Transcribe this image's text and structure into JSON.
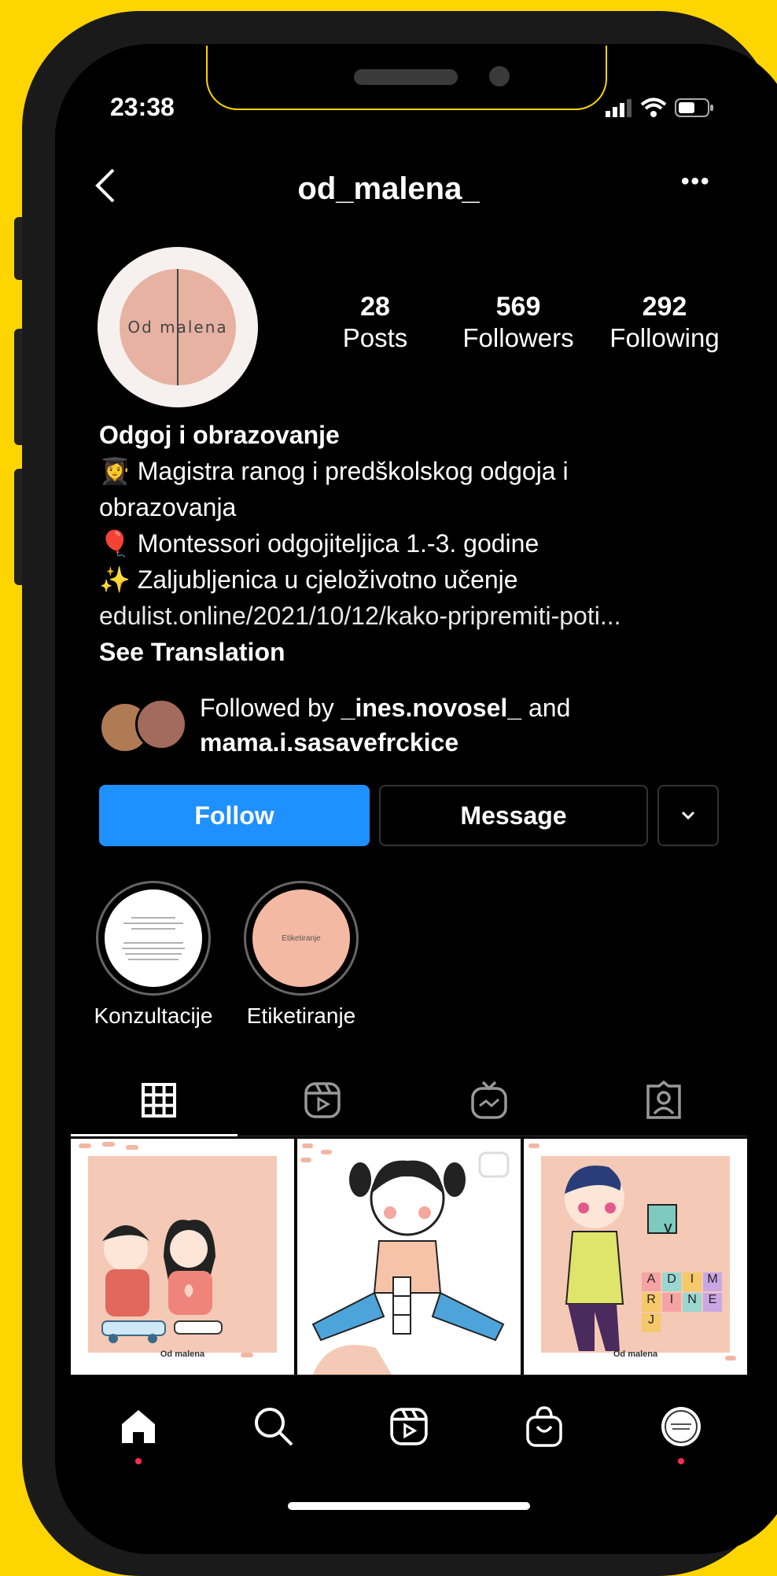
{
  "status_bar": {
    "time": "23:38"
  },
  "header": {
    "username": "od_malena_",
    "back_icon": "chevron-left-icon",
    "more_icon": "ellipsis-icon"
  },
  "profile": {
    "avatar_text": "Od malena",
    "stats": [
      {
        "value": "28",
        "label": "Posts"
      },
      {
        "value": "569",
        "label": "Followers"
      },
      {
        "value": "292",
        "label": "Following"
      }
    ],
    "bio_name": "Odgoj i obrazovanje",
    "bio_lines": [
      "👩‍🎓 Magistra ranog i predškolskog odgoja i",
      "obrazovanja",
      "🎈 Montessori odgojiteljica 1.-3. godine",
      "✨ Zaljubljenica u cjeloživotno učenje"
    ],
    "bio_link": "edulist.online/2021/10/12/kako-pripremiti-poti...",
    "see_translation": "See Translation",
    "followed_by_prefix": "Followed by ",
    "followed_by_user1": "_ines.novosel_",
    "followed_by_and": " and",
    "followed_by_user2": "mama.i.sasavefrckice"
  },
  "actions": {
    "follow": "Follow",
    "message": "Message",
    "dropdown_icon": "chevron-down-icon"
  },
  "highlights": [
    {
      "label": "Konzultacije",
      "cover_color": "#ffffff"
    },
    {
      "label": "Etiketiranje",
      "cover_color": "#F4B9A3",
      "cover_text": "Etiketiranje"
    }
  ],
  "tabs": [
    "grid-icon",
    "reels-icon",
    "igtv-icon",
    "tagged-icon"
  ],
  "posts": [
    {
      "caption": "Od malena",
      "bg": "#F4C9B6"
    },
    {
      "caption": "",
      "bg": "#ffffff"
    },
    {
      "caption": "Od malena",
      "bg": "#F4C9B6",
      "blocks": [
        "V",
        "A",
        "D",
        "I",
        "M",
        "R",
        "I",
        "N",
        "E",
        "J"
      ]
    }
  ],
  "bottom_nav": [
    "home-icon",
    "search-icon",
    "reels-icon",
    "shop-icon",
    "profile-icon"
  ],
  "colors": {
    "background": "#FFD500",
    "follow_button": "#1E90FF",
    "notification_dot": "#ff2b55"
  }
}
